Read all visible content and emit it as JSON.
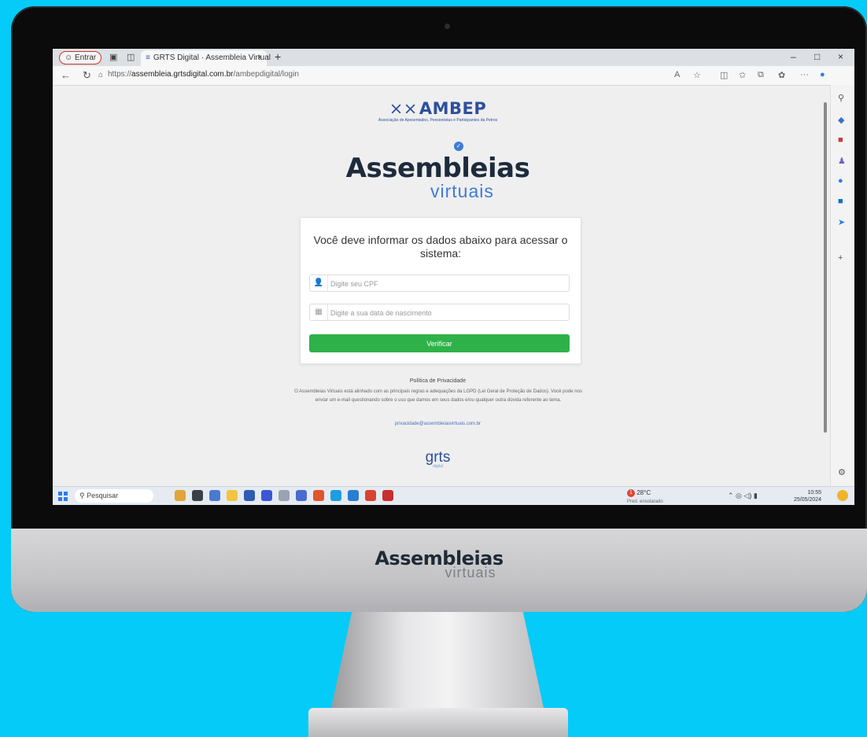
{
  "browser": {
    "profile_label": "Entrar",
    "tab_title": "GRTS Digital · Assembleia Virtual",
    "tab_close": "×",
    "new_tab": "+",
    "url_prefix": "https://",
    "url_host": "assembleia.grtsdigital.com.br",
    "url_path": "/ambepdigital/login",
    "window_controls": [
      "–",
      "□",
      "×"
    ]
  },
  "page": {
    "org_logo": "AMBEP",
    "org_subtitle": "Associação de Aposentados, Pensionistas e Participantes da Petros",
    "brand_main": "Assembleias",
    "brand_sub": "virtuais",
    "form": {
      "title": "Você deve informar os dados abaixo para acessar o sistema:",
      "cpf_placeholder": "Digite seu CPF",
      "birth_placeholder": "Digite a sua data de nascimento",
      "submit_label": "Verificar"
    },
    "privacy": {
      "title": "Política de Privacidade",
      "text": "O Assembleias Virtuais está alinhado com as principais regras e adequações da LGPD (Lei Geral de Proteção de Dados). Você pode nos enviar um e-mail questionando sobre o uso que damos em seus dados e/ou qualquer outra dúvida referente ao tema.",
      "email": "privacidade@assembleiasvirtuais.com.br"
    },
    "footer_logo": "grts",
    "footer_sub": "digital"
  },
  "taskbar": {
    "search_placeholder": "Pesquisar",
    "weather_temp": "28°C",
    "weather_desc": "Pred. ensolarado",
    "weather_badge": "1",
    "time": "10:55",
    "date": "25/05/2024"
  },
  "monitor": {
    "chin_brand": "Assembleias",
    "chin_sub": "virtuais"
  },
  "colors": {
    "background": "#04cbf7",
    "brand_blue": "#2e4f9e",
    "accent_blue": "#3d7bd6",
    "button_green": "#2fb14a"
  }
}
